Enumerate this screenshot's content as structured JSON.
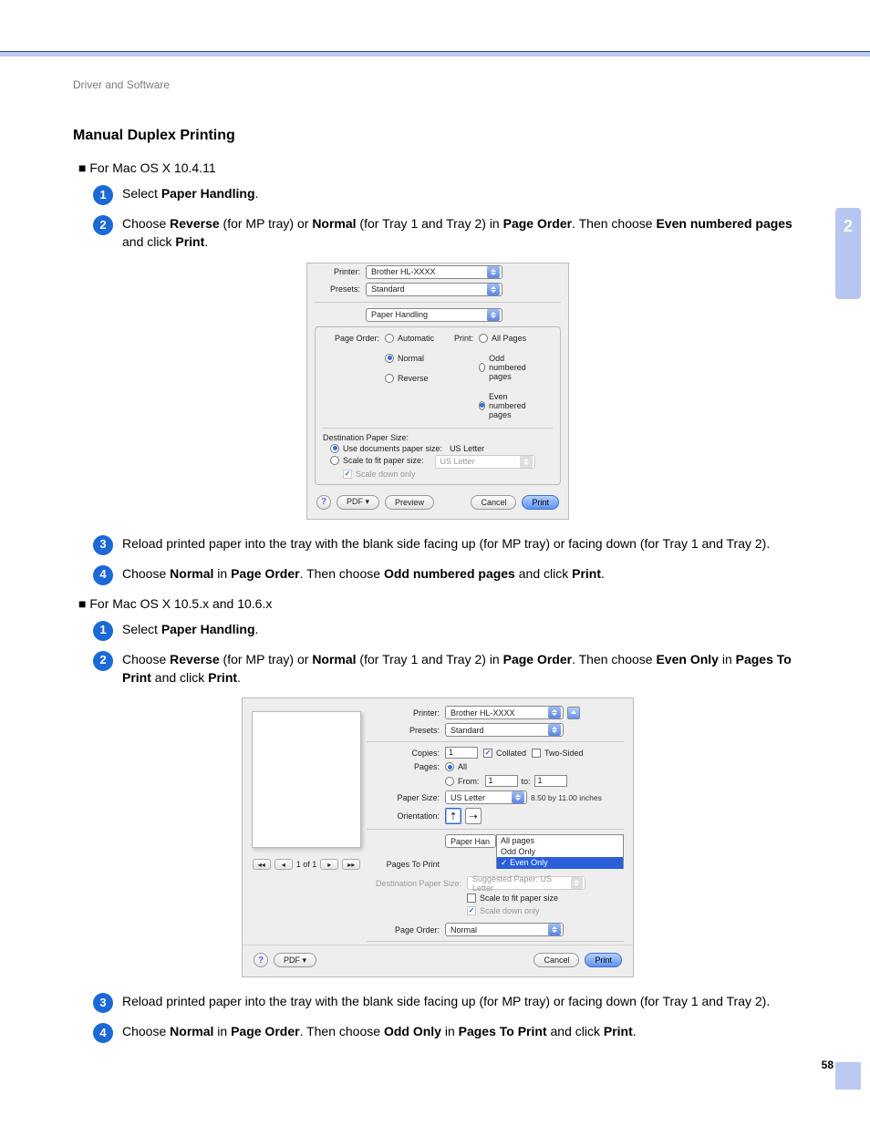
{
  "breadcrumb": "Driver and Software",
  "title": "Manual Duplex Printing",
  "sidetab": "2",
  "pagenum": "58",
  "os1_header": "For Mac OS X 10.4.11",
  "os2_header": "For Mac OS X 10.5.x and 10.6.x",
  "steps_a": {
    "s1_pre": "Select ",
    "s1_b1": "Paper Handling",
    "s1_post": ".",
    "s2_pre": "Choose ",
    "s2_b1": "Reverse",
    "s2_mid1": " (for MP tray) or ",
    "s2_b2": "Normal",
    "s2_mid2": " (for Tray 1 and Tray 2) in ",
    "s2_b3": "Page Order",
    "s2_mid3": ". Then choose ",
    "s2_b4": "Even numbered pages",
    "s2_mid4": " and click ",
    "s2_b5": "Print",
    "s2_post": ".",
    "s3": "Reload printed paper into the tray with the blank side facing up (for MP tray) or facing down (for Tray 1 and Tray 2).",
    "s4_pre": "Choose ",
    "s4_b1": "Normal",
    "s4_mid1": " in ",
    "s4_b2": "Page Order",
    "s4_mid2": ". Then choose ",
    "s4_b3": "Odd numbered pages",
    "s4_mid3": " and click ",
    "s4_b4": "Print",
    "s4_post": "."
  },
  "steps_b": {
    "s1_pre": "Select ",
    "s1_b1": "Paper Handling",
    "s1_post": ".",
    "s2_pre": "Choose ",
    "s2_b1": "Reverse",
    "s2_mid1": " (for MP tray) or ",
    "s2_b2": "Normal",
    "s2_mid2": " (for Tray 1 and Tray 2) in ",
    "s2_b3": "Page Order",
    "s2_mid3": ". Then choose ",
    "s2_b4": "Even Only",
    "s2_mid4": " in ",
    "s2_b5": "Pages To Print",
    "s2_mid5": " and click ",
    "s2_b6": "Print",
    "s2_post": ".",
    "s3": "Reload printed paper into the tray with the blank side facing up (for MP tray) or facing down (for Tray 1 and Tray 2).",
    "s4_pre": "Choose ",
    "s4_b1": "Normal",
    "s4_mid1": " in ",
    "s4_b2": "Page Order",
    "s4_mid2": ". Then choose ",
    "s4_b3": "Odd Only",
    "s4_mid3": " in ",
    "s4_b4": "Pages To Print",
    "s4_mid4": " and click ",
    "s4_b5": "Print",
    "s4_post": "."
  },
  "dlg1": {
    "printer_label": "Printer:",
    "printer_value": "Brother HL-XXXX",
    "presets_label": "Presets:",
    "presets_value": "Standard",
    "section_value": "Paper Handling",
    "page_order_label": "Page Order:",
    "po_auto": "Automatic",
    "po_normal": "Normal",
    "po_reverse": "Reverse",
    "print_label": "Print:",
    "pr_all": "All Pages",
    "pr_odd": "Odd numbered pages",
    "pr_even": "Even numbered pages",
    "dest_title": "Destination Paper Size:",
    "dest_opt1": "Use documents paper size:",
    "dest_opt1_val": "US Letter",
    "dest_opt2": "Scale to fit paper size:",
    "dest_opt2_val": "US Letter",
    "scale_down": "Scale down only",
    "pdf": "PDF ▾",
    "preview": "Preview",
    "cancel": "Cancel",
    "print": "Print",
    "help": "?"
  },
  "dlg2": {
    "printer_label": "Printer:",
    "printer_value": "Brother HL-XXXX",
    "presets_label": "Presets:",
    "presets_value": "Standard",
    "copies_label": "Copies:",
    "copies_value": "1",
    "collated": "Collated",
    "twosided": "Two-Sided",
    "pages_label": "Pages:",
    "pages_all": "All",
    "pages_from": "From:",
    "pages_from_val": "1",
    "pages_to": "to:",
    "pages_to_val": "1",
    "papersize_label": "Paper Size:",
    "papersize_value": "US Letter",
    "papersize_note": "8.50 by 11.00 inches",
    "orientation_label": "Orientation:",
    "section_label": "Paper Han",
    "menu_all": "All pages",
    "menu_odd": "Odd Only",
    "menu_even": "Even Only",
    "pages_to_print_label": "Pages To Print",
    "menu_check": "✓",
    "dest_label": "Destination Paper Size:",
    "dest_value": "Suggested Paper: US Letter",
    "scalefit": "Scale to fit paper size",
    "scaledown": "Scale down only",
    "pageorder_label": "Page Order:",
    "pageorder_value": "Normal",
    "nav_pages": "1 of 1",
    "pdf": "PDF ▾",
    "cancel": "Cancel",
    "print": "Print",
    "help": "?"
  }
}
